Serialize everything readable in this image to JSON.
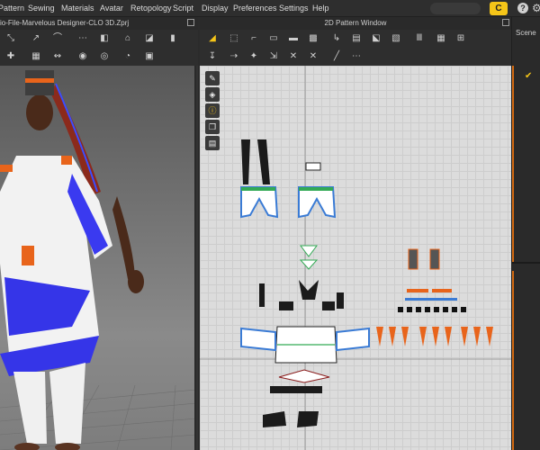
{
  "menu": {
    "items": [
      "Pattern",
      "Sewing",
      "Materials",
      "Avatar",
      "Retopology",
      "Script",
      "Display",
      "Preferences",
      "Settings",
      "Help"
    ]
  },
  "topbar": {
    "logo_text": "C",
    "help_text": "?",
    "settings_text": "⚙"
  },
  "panel_3d": {
    "title": "io-File-Marvelous Designer-CLO  3D.Zprj"
  },
  "panel_2d": {
    "title": "2D Pattern Window"
  },
  "panel_right": {
    "tab": "Scene"
  },
  "colors": {
    "accent": "#f5c518",
    "pattern_outline": "#3a7bd5",
    "fringe_blue": "#2b2be0",
    "orange": "#e8641b",
    "panel": "#333333",
    "canvas": "#dcdcdc"
  }
}
